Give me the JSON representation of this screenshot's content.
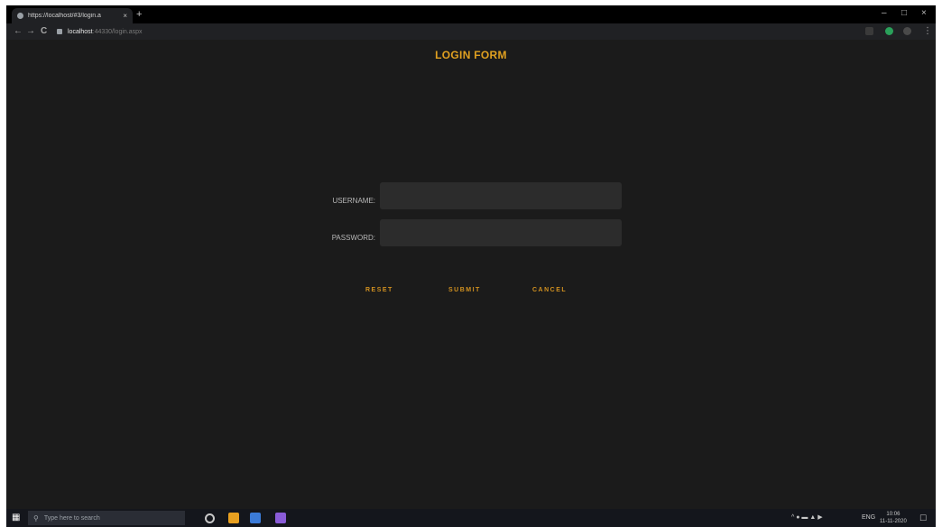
{
  "browser": {
    "tab_title": "https://localhost/#3/login.a",
    "tab_close": "×",
    "new_tab": "+",
    "url_host": "localhost",
    "url_path": ":44330/login.aspx",
    "window_minimize": "–",
    "window_maximize": "□",
    "window_close": "×",
    "back": "←",
    "forward": "→",
    "reload": "C",
    "menu": "⋮"
  },
  "page": {
    "title": "LOGIN FORM",
    "username_label": "USERNAME:",
    "password_label": "PASSWORD:",
    "username_value": "",
    "password_value": "",
    "buttons": {
      "reset": "RESET",
      "submit": "SUBMIT",
      "cancel": "CANCEL"
    }
  },
  "taskbar": {
    "search_placeholder": "Type here to search",
    "tray_lang": "ENG",
    "tray_time": "10:06",
    "tray_date": "11-11-2020"
  },
  "colors": {
    "page_background": "#1b1b1b",
    "accent": "#e0a020",
    "input_background": "#2c2c2c"
  }
}
